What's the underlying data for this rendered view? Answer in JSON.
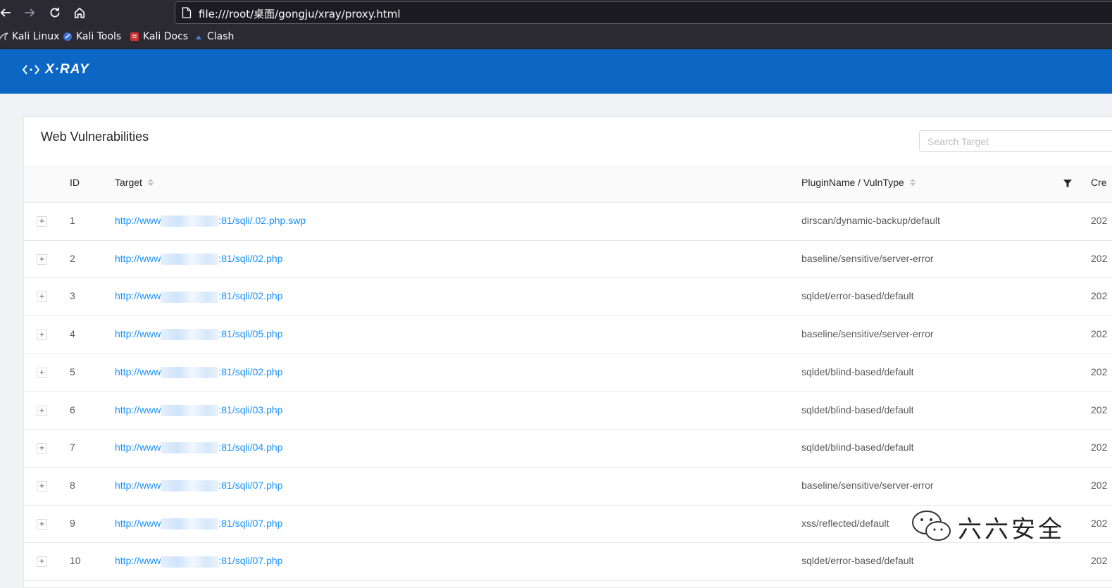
{
  "browser": {
    "url": "file:///root/桌面/gongju/xray/proxy.html",
    "nav": {
      "back_icon": "arrow-left-icon",
      "forward_icon": "arrow-right-icon",
      "reload_icon": "reload-icon",
      "home_icon": "home-icon"
    },
    "bookmarks": [
      {
        "label": "Kali Linux",
        "icon": "kali-dragon-icon"
      },
      {
        "label": "Kali Tools",
        "icon": "kali-tools-icon"
      },
      {
        "label": "Kali Docs",
        "icon": "kali-docs-icon"
      },
      {
        "label": "Clash",
        "icon": "clash-icon"
      }
    ]
  },
  "app": {
    "logo_text": "X·RAY",
    "accent": "#0b66c4"
  },
  "vuln_panel": {
    "title": "Web Vulnerabilities",
    "search_placeholder": "Search Target",
    "columns": {
      "id": "ID",
      "target": "Target",
      "plugin": "PluginName / VulnType",
      "created": "Cre"
    },
    "rows": [
      {
        "id": "1",
        "target_prefix": "http://www",
        "target_suffix": ":81/sqli/.02.php.swp",
        "plugin": "dirscan/dynamic-backup/default",
        "created": "202"
      },
      {
        "id": "2",
        "target_prefix": "http://www",
        "target_suffix": ":81/sqli/02.php",
        "plugin": "baseline/sensitive/server-error",
        "created": "202"
      },
      {
        "id": "3",
        "target_prefix": "http://www",
        "target_suffix": ":81/sqli/02.php",
        "plugin": "sqldet/error-based/default",
        "created": "202"
      },
      {
        "id": "4",
        "target_prefix": "http://www",
        "target_suffix": ":81/sqli/05.php",
        "plugin": "baseline/sensitive/server-error",
        "created": "202"
      },
      {
        "id": "5",
        "target_prefix": "http://www",
        "target_suffix": ":81/sqli/02.php",
        "plugin": "sqldet/blind-based/default",
        "created": "202"
      },
      {
        "id": "6",
        "target_prefix": "http://www",
        "target_suffix": ":81/sqli/03.php",
        "plugin": "sqldet/blind-based/default",
        "created": "202"
      },
      {
        "id": "7",
        "target_prefix": "http://www",
        "target_suffix": ":81/sqli/04.php",
        "plugin": "sqldet/blind-based/default",
        "created": "202"
      },
      {
        "id": "8",
        "target_prefix": "http://www",
        "target_suffix": ":81/sqli/07.php",
        "plugin": "baseline/sensitive/server-error",
        "created": "202"
      },
      {
        "id": "9",
        "target_prefix": "http://www",
        "target_suffix": ":81/sqli/07.php",
        "plugin": "xss/reflected/default",
        "created": "202"
      },
      {
        "id": "10",
        "target_prefix": "http://www",
        "target_suffix": ":81/sqli/07.php",
        "plugin": "sqldet/error-based/default",
        "created": "202"
      }
    ],
    "expand_symbol": "+"
  },
  "watermark": {
    "text": "六六安全",
    "icon": "wechat-icon"
  }
}
